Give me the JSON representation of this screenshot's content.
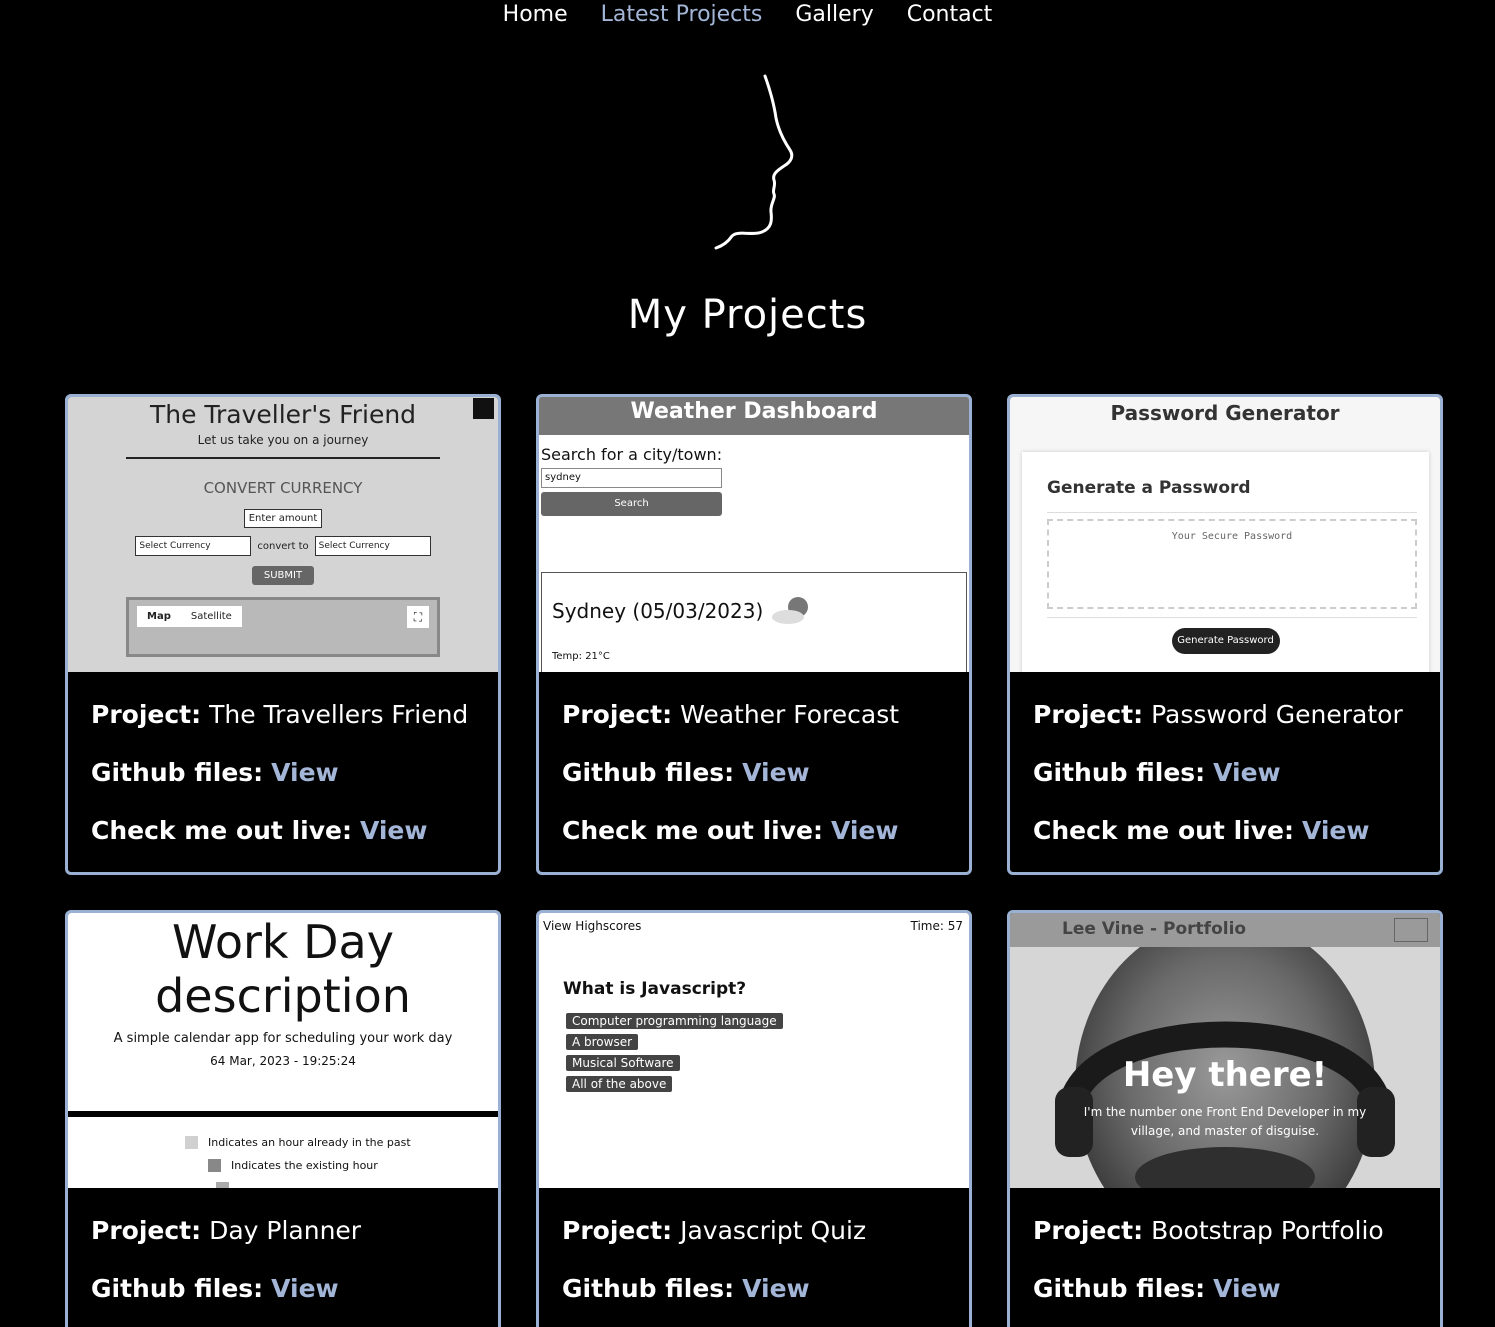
{
  "nav": {
    "items": [
      {
        "label": "Home"
      },
      {
        "label": "Latest Projects"
      },
      {
        "label": "Gallery"
      },
      {
        "label": "Contact"
      }
    ]
  },
  "page": {
    "title": "My Projects"
  },
  "labels": {
    "project": "Project:",
    "github": "Github files:",
    "live": "Check me out live:",
    "view": "View"
  },
  "colors": {
    "accent": "#a3b6d8",
    "border": "#9bb1d4",
    "background": "#000000"
  },
  "projects": [
    {
      "name": "The Travellers Friend",
      "thumb": {
        "title": "The Traveller's Friend",
        "subtitle": "Let us take you on a journey",
        "section": "CONVERT CURRENCY",
        "amount_placeholder": "Enter amount",
        "select_label": "Select Currency",
        "convert_to": "convert to",
        "submit": "SUBMIT",
        "map_tab": "Map",
        "satellite_tab": "Satellite"
      }
    },
    {
      "name": "Weather Forecast",
      "thumb": {
        "title": "Weather Dashboard",
        "search_label": "Search for a city/town:",
        "search_value": "sydney",
        "search_button": "Search",
        "city": "Sydney (05/03/2023)",
        "temp": "Temp: 21°C"
      }
    },
    {
      "name": "Password Generator",
      "thumb": {
        "title": "Password Generator",
        "panel_title": "Generate a Password",
        "placeholder": "Your Secure Password",
        "button": "Generate Password"
      }
    },
    {
      "name": "Day Planner",
      "thumb": {
        "title_line1": "Work Day",
        "title_line2": "description",
        "subtitle": "A simple calendar app for scheduling your work day",
        "datetime": "64 Mar, 2023 - 19:25:24",
        "legend_past": "Indicates an hour already in the past",
        "legend_present": "Indicates the existing hour"
      }
    },
    {
      "name": "Javascript Quiz",
      "thumb": {
        "highscores": "View Highscores",
        "time": "Time: 57",
        "question": "What is Javascript?",
        "answers": [
          "Computer programming language",
          "A browser",
          "Musical Software",
          "All of the above"
        ]
      }
    },
    {
      "name": "Bootstrap Portfolio",
      "thumb": {
        "brand": "Lee Vine - Portfolio",
        "headline": "Hey there!",
        "tagline": "I'm the number one Front End Developer in my village, and master of disguise."
      }
    }
  ]
}
